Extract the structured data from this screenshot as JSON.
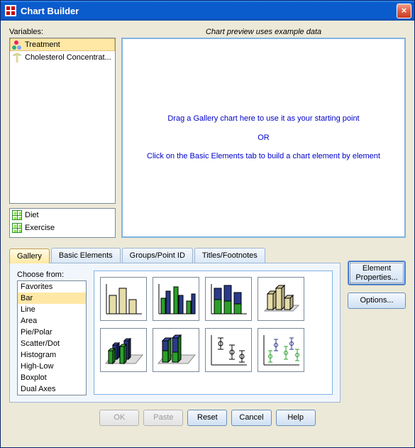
{
  "window": {
    "title": "Chart Builder",
    "close_tooltip": "Close"
  },
  "variables": {
    "label": "Variables:",
    "main": [
      {
        "name": "Treatment",
        "icon": "nominal",
        "selected": true
      },
      {
        "name": "Cholesterol Concentrat...",
        "icon": "scale",
        "selected": false
      }
    ],
    "panel": [
      {
        "name": "Diet",
        "icon": "grid"
      },
      {
        "name": "Exercise",
        "icon": "grid"
      }
    ]
  },
  "preview": {
    "label": "Chart preview uses example data",
    "line1": "Drag a Gallery chart here to use it as your starting point",
    "or": "OR",
    "line2": "Click on the Basic Elements tab to build a chart element by element"
  },
  "tabs": {
    "items": [
      {
        "label": "Gallery",
        "active": true
      },
      {
        "label": "Basic Elements",
        "active": false
      },
      {
        "label": "Groups/Point ID",
        "active": false
      },
      {
        "label": "Titles/Footnotes",
        "active": false
      }
    ]
  },
  "gallery": {
    "choose_label": "Choose from:",
    "types": [
      "Favorites",
      "Bar",
      "Line",
      "Area",
      "Pie/Polar",
      "Scatter/Dot",
      "Histogram",
      "High-Low",
      "Boxplot",
      "Dual Axes"
    ],
    "selected_type": "Bar",
    "thumbs": [
      {
        "name": "bar-simple"
      },
      {
        "name": "bar-clustered"
      },
      {
        "name": "bar-stacked"
      },
      {
        "name": "bar-3d-simple"
      },
      {
        "name": "bar-3d-clustered"
      },
      {
        "name": "bar-3d-stacked"
      },
      {
        "name": "error-bar-simple"
      },
      {
        "name": "error-bar-clustered"
      }
    ]
  },
  "side_buttons": {
    "element_properties": "Element Properties...",
    "options": "Options..."
  },
  "bottom_buttons": {
    "ok": "OK",
    "paste": "Paste",
    "reset": "Reset",
    "cancel": "Cancel",
    "help": "Help"
  }
}
